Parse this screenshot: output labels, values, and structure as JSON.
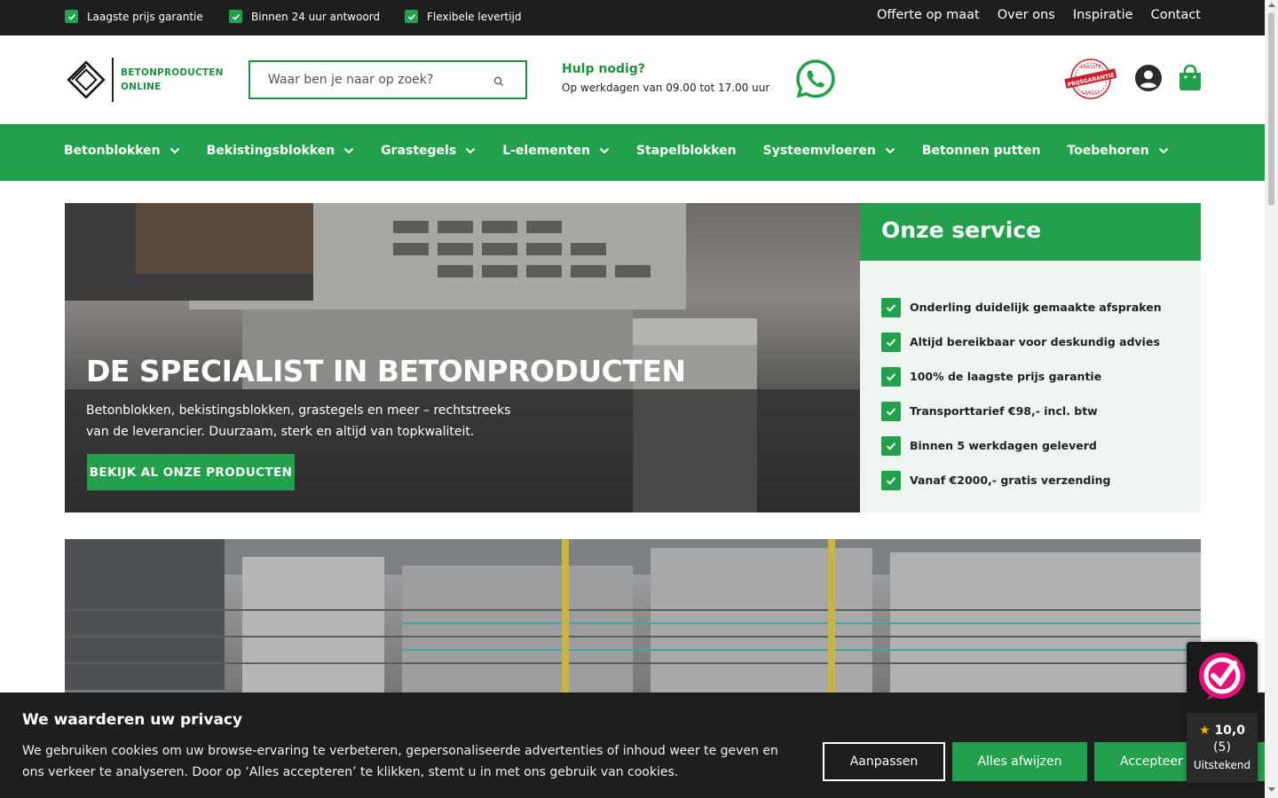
{
  "topbar": {
    "usps": [
      "Laagste prijs garantie",
      "Binnen 24 uur antwoord",
      "Flexibele levertijd"
    ],
    "links": [
      "Offerte op maat",
      "Over ons",
      "Inspiratie",
      "Contact"
    ]
  },
  "header": {
    "logo_line1": "BETONPRODUCTEN",
    "logo_line2": "ONLINE",
    "search_placeholder": "Waar ben je naar op zoek?",
    "help_title": "Hulp nodig?",
    "help_hours": "Op werkdagen van 09.00 tot 17.00 uur",
    "badge_top": "LAAGSTE",
    "badge_mid": "PRIJSGARANTIE",
    "badge_bottom": "LAAGST"
  },
  "nav": {
    "items": [
      {
        "label": "Betonblokken",
        "dropdown": true
      },
      {
        "label": "Bekistingsblokken",
        "dropdown": true
      },
      {
        "label": "Grastegels",
        "dropdown": true
      },
      {
        "label": "L-elementen",
        "dropdown": true
      },
      {
        "label": "Stapelblokken",
        "dropdown": false
      },
      {
        "label": "Systeemvloeren",
        "dropdown": true
      },
      {
        "label": "Betonnen putten",
        "dropdown": false
      },
      {
        "label": "Toebehoren",
        "dropdown": true
      }
    ]
  },
  "hero": {
    "title": "DE SPECIALIST IN BETONPRODUCTEN",
    "text": "Betonblokken, bekistingsblokken, grastegels en meer – rechtstreeks van de leverancier. Duurzaam, sterk en altijd van topkwaliteit.",
    "cta": "BEKIJK AL ONZE PRODUCTEN"
  },
  "service": {
    "title": "Onze service",
    "items": [
      "Onderling duidelijk gemaakte afspraken",
      "Altijd bereikbaar voor deskundig advies",
      "100% de laagste prijs garantie",
      "Transporttarief €98,- incl. btw",
      "Binnen 5 werkdagen geleverd",
      "Vanaf €2000,- gratis verzending"
    ]
  },
  "cookie": {
    "title": "We waarderen uw privacy",
    "text": "We gebruiken cookies om uw browse-ervaring te verbeteren, gepersonaliseerde advertenties of inhoud weer te geven en ons verkeer te analyseren. Door op ‘Alles accepteren’ te klikken, stemt u in met ons gebruik van cookies.",
    "btn_customize": "Aanpassen",
    "btn_reject": "Alles afwijzen",
    "btn_accept": "Accepteer"
  },
  "review": {
    "score": "10,0",
    "count": "(5)",
    "label": "Uitstekend"
  },
  "colors": {
    "brand_green": "#22a04b",
    "dark": "#1e1e1e"
  }
}
